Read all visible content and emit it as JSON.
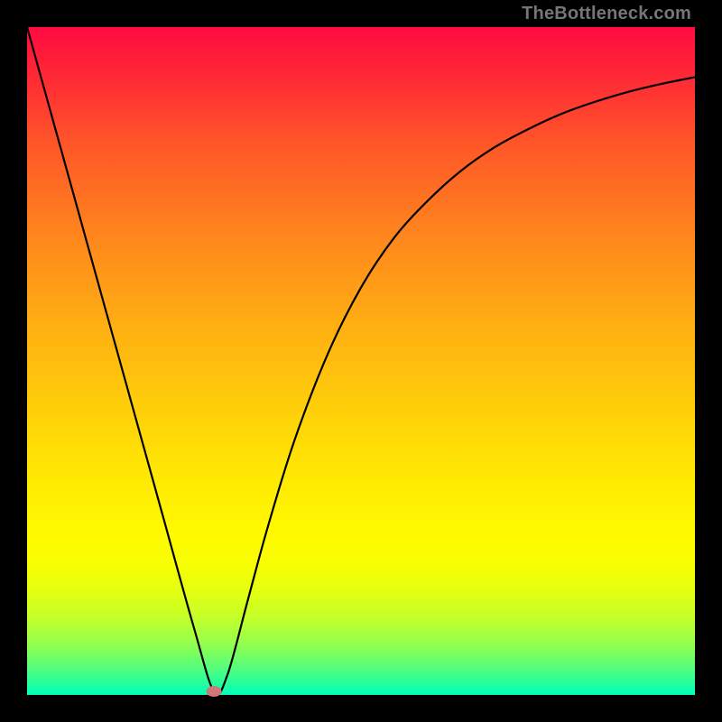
{
  "watermark": "TheBottleneck.com",
  "chart_data": {
    "type": "line",
    "title": "",
    "xlabel": "",
    "ylabel": "",
    "xlim": [
      0,
      100
    ],
    "ylim": [
      0,
      100
    ],
    "grid": false,
    "legend": false,
    "background_gradient": {
      "top": "#ff0b41",
      "bottom": "#00ffb8"
    },
    "series": [
      {
        "name": "curve",
        "color": "#000000",
        "x": [
          0,
          5,
          10,
          15,
          20,
          25,
          28,
          30,
          33,
          36,
          40,
          45,
          50,
          55,
          60,
          65,
          70,
          75,
          80,
          85,
          90,
          95,
          100
        ],
        "y": [
          100,
          82,
          64,
          46,
          28,
          10,
          0.5,
          3,
          14,
          25,
          38,
          51,
          61,
          68.5,
          74,
          78.5,
          82,
          84.7,
          87,
          88.8,
          90.3,
          91.5,
          92.5
        ]
      }
    ],
    "markers": [
      {
        "name": "min-point",
        "x": 28,
        "y": 0.5,
        "color": "#cf7877"
      }
    ]
  }
}
